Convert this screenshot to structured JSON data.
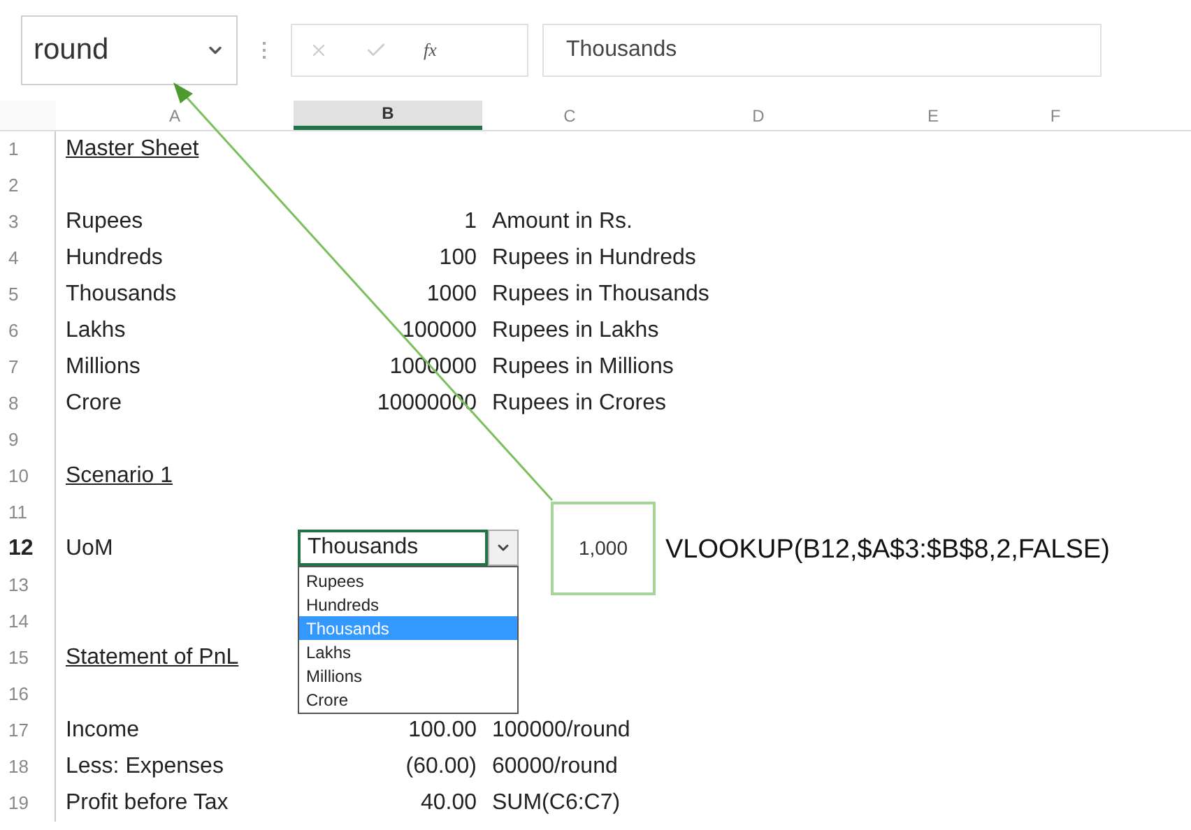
{
  "name_box": {
    "value": "round"
  },
  "formula_bar": {
    "function_label": "fx",
    "value": "Thousands"
  },
  "columns": [
    {
      "label": "A",
      "selected": false
    },
    {
      "label": "B",
      "selected": true
    },
    {
      "label": "C",
      "selected": false
    },
    {
      "label": "D",
      "selected": false
    },
    {
      "label": "E",
      "selected": false
    },
    {
      "label": "F",
      "selected": false
    }
  ],
  "rows": [
    {
      "number": "1",
      "selected": false,
      "a": {
        "text": "Master Sheet",
        "kind": "heading"
      }
    },
    {
      "number": "2",
      "selected": false
    },
    {
      "number": "3",
      "selected": false,
      "a": {
        "text": "Rupees",
        "kind": "text"
      },
      "b": {
        "text": "1",
        "kind": "number"
      },
      "c": {
        "text": "Amount in Rs.",
        "kind": "text"
      }
    },
    {
      "number": "4",
      "selected": false,
      "a": {
        "text": "Hundreds",
        "kind": "text"
      },
      "b": {
        "text": "100",
        "kind": "number"
      },
      "c": {
        "text": "Rupees in Hundreds",
        "kind": "text"
      }
    },
    {
      "number": "5",
      "selected": false,
      "a": {
        "text": "Thousands",
        "kind": "text"
      },
      "b": {
        "text": "1000",
        "kind": "number"
      },
      "c": {
        "text": "Rupees in Thousands",
        "kind": "text"
      }
    },
    {
      "number": "6",
      "selected": false,
      "a": {
        "text": "Lakhs",
        "kind": "text"
      },
      "b": {
        "text": "100000",
        "kind": "number"
      },
      "c": {
        "text": "Rupees in Lakhs",
        "kind": "text"
      }
    },
    {
      "number": "7",
      "selected": false,
      "a": {
        "text": "Millions",
        "kind": "text"
      },
      "b": {
        "text": "1000000",
        "kind": "number"
      },
      "c": {
        "text": "Rupees in Millions",
        "kind": "text"
      }
    },
    {
      "number": "8",
      "selected": false,
      "a": {
        "text": "Crore",
        "kind": "text"
      },
      "b": {
        "text": "10000000",
        "kind": "number"
      },
      "c": {
        "text": "Rupees in Crores",
        "kind": "text"
      }
    },
    {
      "number": "9",
      "selected": false
    },
    {
      "number": "10",
      "selected": false,
      "a": {
        "text": "Scenario 1",
        "kind": "heading"
      }
    },
    {
      "number": "11",
      "selected": false
    },
    {
      "number": "12",
      "selected": true,
      "a": {
        "text": "UoM",
        "kind": "text"
      }
    },
    {
      "number": "13",
      "selected": false
    },
    {
      "number": "14",
      "selected": false
    },
    {
      "number": "15",
      "selected": false,
      "a": {
        "text": "Statement of PnL",
        "kind": "heading"
      }
    },
    {
      "number": "16",
      "selected": false
    },
    {
      "number": "17",
      "selected": false,
      "a": {
        "text": "Income",
        "kind": "text"
      },
      "b": {
        "text": "100.00",
        "kind": "number"
      },
      "c": {
        "text": "100000/round",
        "kind": "text"
      }
    },
    {
      "number": "18",
      "selected": false,
      "a": {
        "text": "Less: Expenses",
        "kind": "text"
      },
      "b": {
        "text": "(60.00)",
        "kind": "number"
      },
      "c": {
        "text": "60000/round",
        "kind": "text"
      }
    },
    {
      "number": "19",
      "selected": false,
      "a": {
        "text": "Profit before Tax",
        "kind": "text"
      },
      "b": {
        "text": "40.00",
        "kind": "number"
      },
      "c": {
        "text": "SUM(C6:C7)",
        "kind": "text"
      }
    }
  ],
  "dropdown": {
    "value": "Thousands",
    "options": [
      {
        "label": "Rupees",
        "selected": false
      },
      {
        "label": "Hundreds",
        "selected": false
      },
      {
        "label": "Thousands",
        "selected": true
      },
      {
        "label": "Lakhs",
        "selected": false
      },
      {
        "label": "Millions",
        "selected": false
      },
      {
        "label": "Crore",
        "selected": false
      }
    ]
  },
  "callout": {
    "result": "1,000",
    "formula": "VLOOKUP(B12,$A$3:$B$8,2,FALSE)"
  }
}
